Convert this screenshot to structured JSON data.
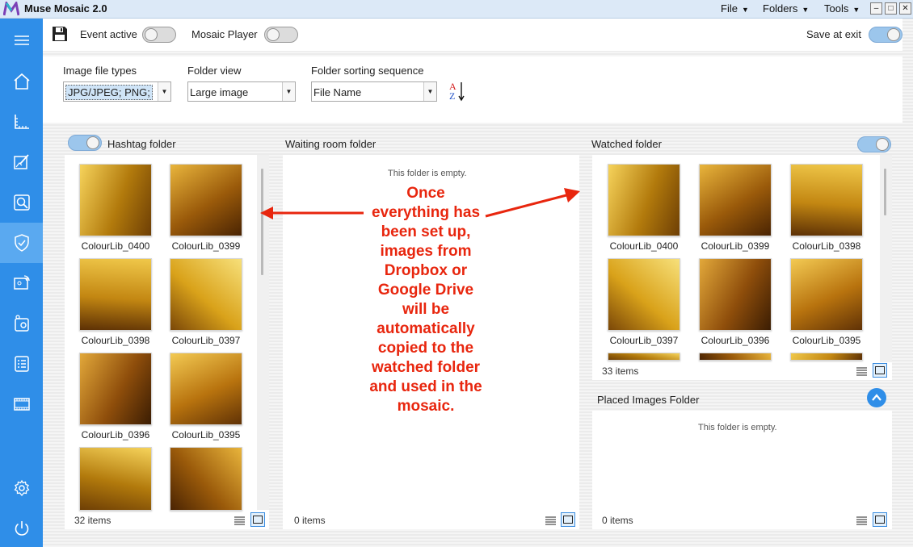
{
  "app": {
    "title": "Muse Mosaic 2.0"
  },
  "menu": {
    "file": "File",
    "folders": "Folders",
    "tools": "Tools"
  },
  "window_controls": {
    "minimize": "–",
    "maximize": "□",
    "close": "✕"
  },
  "sidebar": {
    "items": [
      {
        "icon": "hamburger-icon"
      },
      {
        "icon": "home-icon"
      },
      {
        "icon": "ruler-icon"
      },
      {
        "icon": "edit-image-icon"
      },
      {
        "icon": "search-image-icon"
      },
      {
        "icon": "shield-icon",
        "active": true
      },
      {
        "icon": "cast-icon"
      },
      {
        "icon": "image-settings-icon"
      },
      {
        "icon": "checklist-icon"
      },
      {
        "icon": "film-icon"
      },
      {
        "icon": "gear-icon"
      },
      {
        "icon": "power-icon"
      }
    ]
  },
  "toolbar": {
    "event_active": "Event active",
    "mosaic_player": "Mosaic Player",
    "save_at_exit": "Save at exit"
  },
  "settings": {
    "file_types_label": "Image file types",
    "file_types_value": "JPG/JPEG; PNG;",
    "folder_view_label": "Folder view",
    "folder_view_value": "Large image",
    "sorting_label": "Folder sorting sequence",
    "sorting_value": "File Name",
    "sort_a": "A",
    "sort_z": "Z"
  },
  "hashtag": {
    "title": "Hashtag folder",
    "items": [
      "ColourLib_0400",
      "ColourLib_0399",
      "ColourLib_0398",
      "ColourLib_0397",
      "ColourLib_0396",
      "ColourLib_0395",
      "",
      ""
    ],
    "count": "32 items"
  },
  "waiting": {
    "title": "Waiting room folder",
    "empty": "This folder is empty.",
    "count": "0 items"
  },
  "watched": {
    "title": "Watched folder",
    "items": [
      "ColourLib_0400",
      "ColourLib_0399",
      "ColourLib_0398",
      "ColourLib_0397",
      "ColourLib_0396",
      "ColourLib_0395"
    ],
    "count": "33 items"
  },
  "placed": {
    "title": "Placed Images Folder",
    "empty": "This folder is empty.",
    "count": "0 items"
  },
  "annotation": "Once everything has been set up, images from Dropbox or Google Drive will be automatically copied to the watched folder and used in the mosaic.",
  "colors": {
    "sidebar": "#2f8ee8",
    "annotation": "#e8260e",
    "gold": "#d9a21a"
  }
}
